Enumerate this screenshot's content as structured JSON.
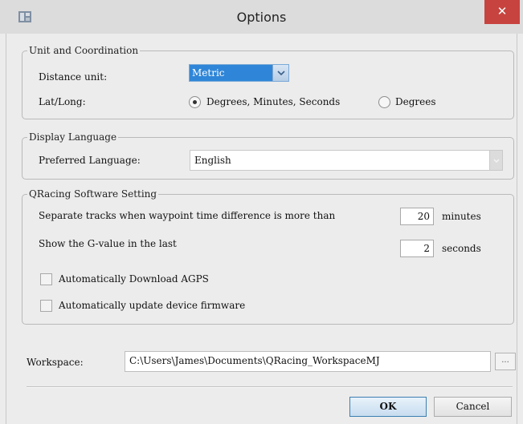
{
  "window": {
    "title": "Options",
    "close_label": "✕"
  },
  "unit_group": {
    "legend": "Unit and Coordination",
    "distance_label": "Distance unit:",
    "distance_value": "Metric",
    "latlong_label": "Lat/Long:",
    "radio_dms_label": "Degrees, Minutes, Seconds",
    "radio_deg_label": "Degrees",
    "selected": "dms"
  },
  "language_group": {
    "legend": "Display Language",
    "preferred_label": "Preferred Language:",
    "preferred_value": "English"
  },
  "qracing_group": {
    "legend": "QRacing Software Setting",
    "separate_label": "Separate tracks when waypoint time difference is more than",
    "separate_value": "20",
    "separate_unit": "minutes",
    "gvalue_label": "Show the G-value in the last",
    "gvalue_value": "2",
    "gvalue_unit": "seconds",
    "agps_label": "Automatically Download AGPS",
    "agps_checked": false,
    "firmware_label": "Automatically update device firmware",
    "firmware_checked": false
  },
  "workspace": {
    "label": "Workspace:",
    "path": "C:\\Users\\James\\Documents\\QRacing_WorkspaceMJ",
    "browse_label": "..."
  },
  "buttons": {
    "ok_label": "OK",
    "cancel_label": "Cancel"
  },
  "colors": {
    "close": "#c7433f",
    "selection": "#2f86d8",
    "ok_border": "#3c7fb1"
  }
}
